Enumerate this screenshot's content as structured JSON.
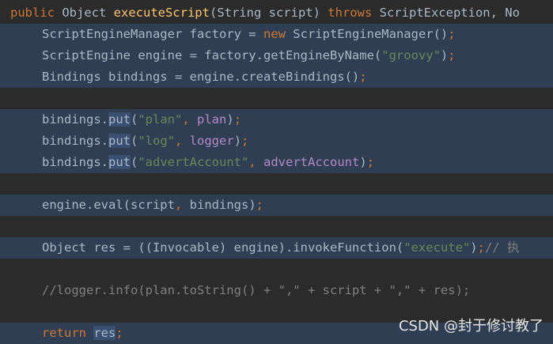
{
  "lines": {
    "l1": {
      "kw_public": "public",
      "t1": " Object ",
      "fn": "executeScript",
      "t2": "(String script) ",
      "kw_throws": "throws",
      "t3": " ScriptException, No"
    },
    "l2": {
      "t1": "ScriptEngineManager factory = ",
      "kw_new": "new",
      "t2": " ScriptEngineManager()",
      ";": ";"
    },
    "l3": {
      "t1": "ScriptEngine engine = factory.getEngineByName(",
      "str": "\"groovy\"",
      "t2": ")",
      ";": ";"
    },
    "l4": {
      "t1": "Bindings bindings = engine.createBindings()",
      ";": ";"
    },
    "l6": {
      "t1": "bindings.",
      "put": "put",
      "t2": "(",
      "str": "\"plan\"",
      "comma": ", ",
      "param": "plan",
      "t3": ")",
      ";": ";"
    },
    "l7": {
      "t1": "bindings.",
      "put": "put",
      "t2": "(",
      "str": "\"log\"",
      "comma": ", ",
      "param": "logger",
      "t3": ")",
      ";": ";"
    },
    "l8": {
      "t1": "bindings.",
      "put": "put",
      "t2": "(",
      "str": "\"advertAccount\"",
      "comma": ", ",
      "param": "advertAccount",
      "t3": ")",
      ";": ";"
    },
    "l10": {
      "t1": "engine.eval(script",
      ",": ",",
      "t2": " bindings)",
      ";": ";"
    },
    "l12": {
      "t1": "Object res = ((Invocable) engine).invokeFunction(",
      "str": "\"execute\"",
      "t2": ")",
      ";": ";",
      "cmt": "// 执"
    },
    "l14": {
      "cmt": "//logger.info(plan.toString() + \",\" + script + \",\" + res);"
    },
    "l16": {
      "kw_return": "return",
      "t1": " ",
      "res": "res",
      ";": ";"
    }
  },
  "watermark": "CSDN @封于修讨教了",
  "colors": {
    "background": "#2b2b2b",
    "selected_line": "#2f3e52",
    "keyword": "#cc7832",
    "function": "#ffc66d",
    "string": "#6a8759",
    "parameter": "#b389c5",
    "comment": "#808080",
    "text": "#a9b7c6"
  }
}
